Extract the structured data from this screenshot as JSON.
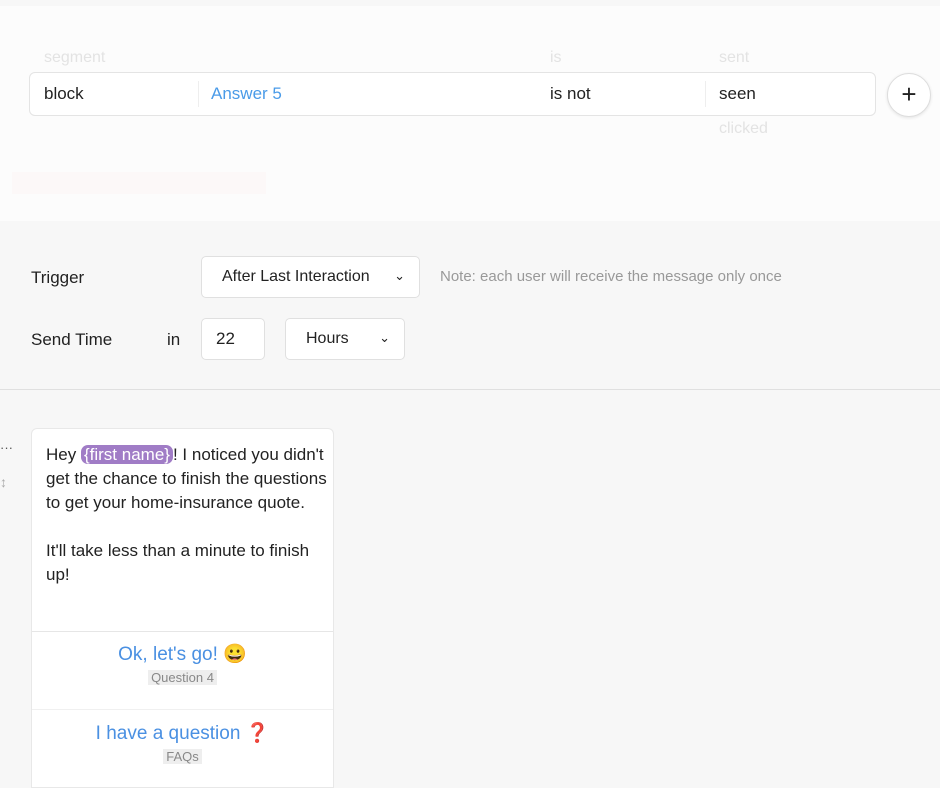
{
  "filter": {
    "headers": {
      "segment": "segment",
      "is": "is",
      "sent": "sent"
    },
    "row": {
      "type": "block",
      "value": "Answer 5",
      "operator": "is not",
      "status": "seen"
    },
    "option_below": "clicked",
    "add_label": "+"
  },
  "trigger": {
    "label": "Trigger",
    "value": "After Last Interaction",
    "note": "Note: each user will receive the message only once"
  },
  "send_time": {
    "label": "Send Time",
    "in": "in",
    "amount": "22",
    "unit": "Hours"
  },
  "message": {
    "prefix": "Hey ",
    "variable": "{first name}",
    "line1_rest": "! I noticed you didn't get the chance to finish the questions to get your home-insurance quote.",
    "line2": "It'll take less than a minute to finish up!",
    "buttons": [
      {
        "label": "Ok, let's go! 😀",
        "target": "Question 4"
      },
      {
        "label": "I have a question ❓",
        "target": "FAQs"
      }
    ]
  },
  "side": {
    "more": "···",
    "drag": "↕"
  }
}
